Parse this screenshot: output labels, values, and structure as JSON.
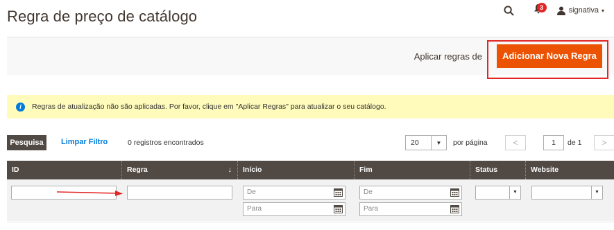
{
  "page": {
    "title": "Regra de preço de catálogo"
  },
  "header": {
    "search_icon": "search-icon",
    "bell_icon": "bell-icon",
    "notification_count": "3",
    "user_icon": "user-icon",
    "username": "signativa",
    "user_caret": "▾"
  },
  "actions": {
    "apply_label": "Aplicar regras de",
    "add_button_label": "Adicionar Nova Regra",
    "accent_color": "#eb5202",
    "highlight_color": "#e22626"
  },
  "notice": {
    "icon": "info-icon",
    "icon_glyph": "i",
    "text": "Regras de atualização não são aplicadas. Por favor, clique em \"Aplicar Regras\" para atualizar o seu catálogo."
  },
  "toolbar": {
    "search_label": "Pesquisa",
    "clear_label": "Limpar Filtro",
    "records_text": "0 registros encontrados",
    "per_page_value": "20",
    "per_page_arrow": "▼",
    "per_page_label": "por página",
    "prev_glyph": "<",
    "next_glyph": ">",
    "page_current": "1",
    "page_of": "de 1"
  },
  "grid": {
    "columns": [
      {
        "label": "ID"
      },
      {
        "label": "Regra",
        "sort": "↓"
      },
      {
        "label": "Início"
      },
      {
        "label": "Fim"
      },
      {
        "label": "Status"
      },
      {
        "label": "Website"
      }
    ],
    "filters": {
      "id_value": "",
      "rule_value": "",
      "start_from_placeholder": "De",
      "start_to_placeholder": "Para",
      "end_from_placeholder": "De",
      "end_to_placeholder": "Para",
      "status_selected": "",
      "website_selected": "",
      "select_arrow": "▼"
    }
  }
}
